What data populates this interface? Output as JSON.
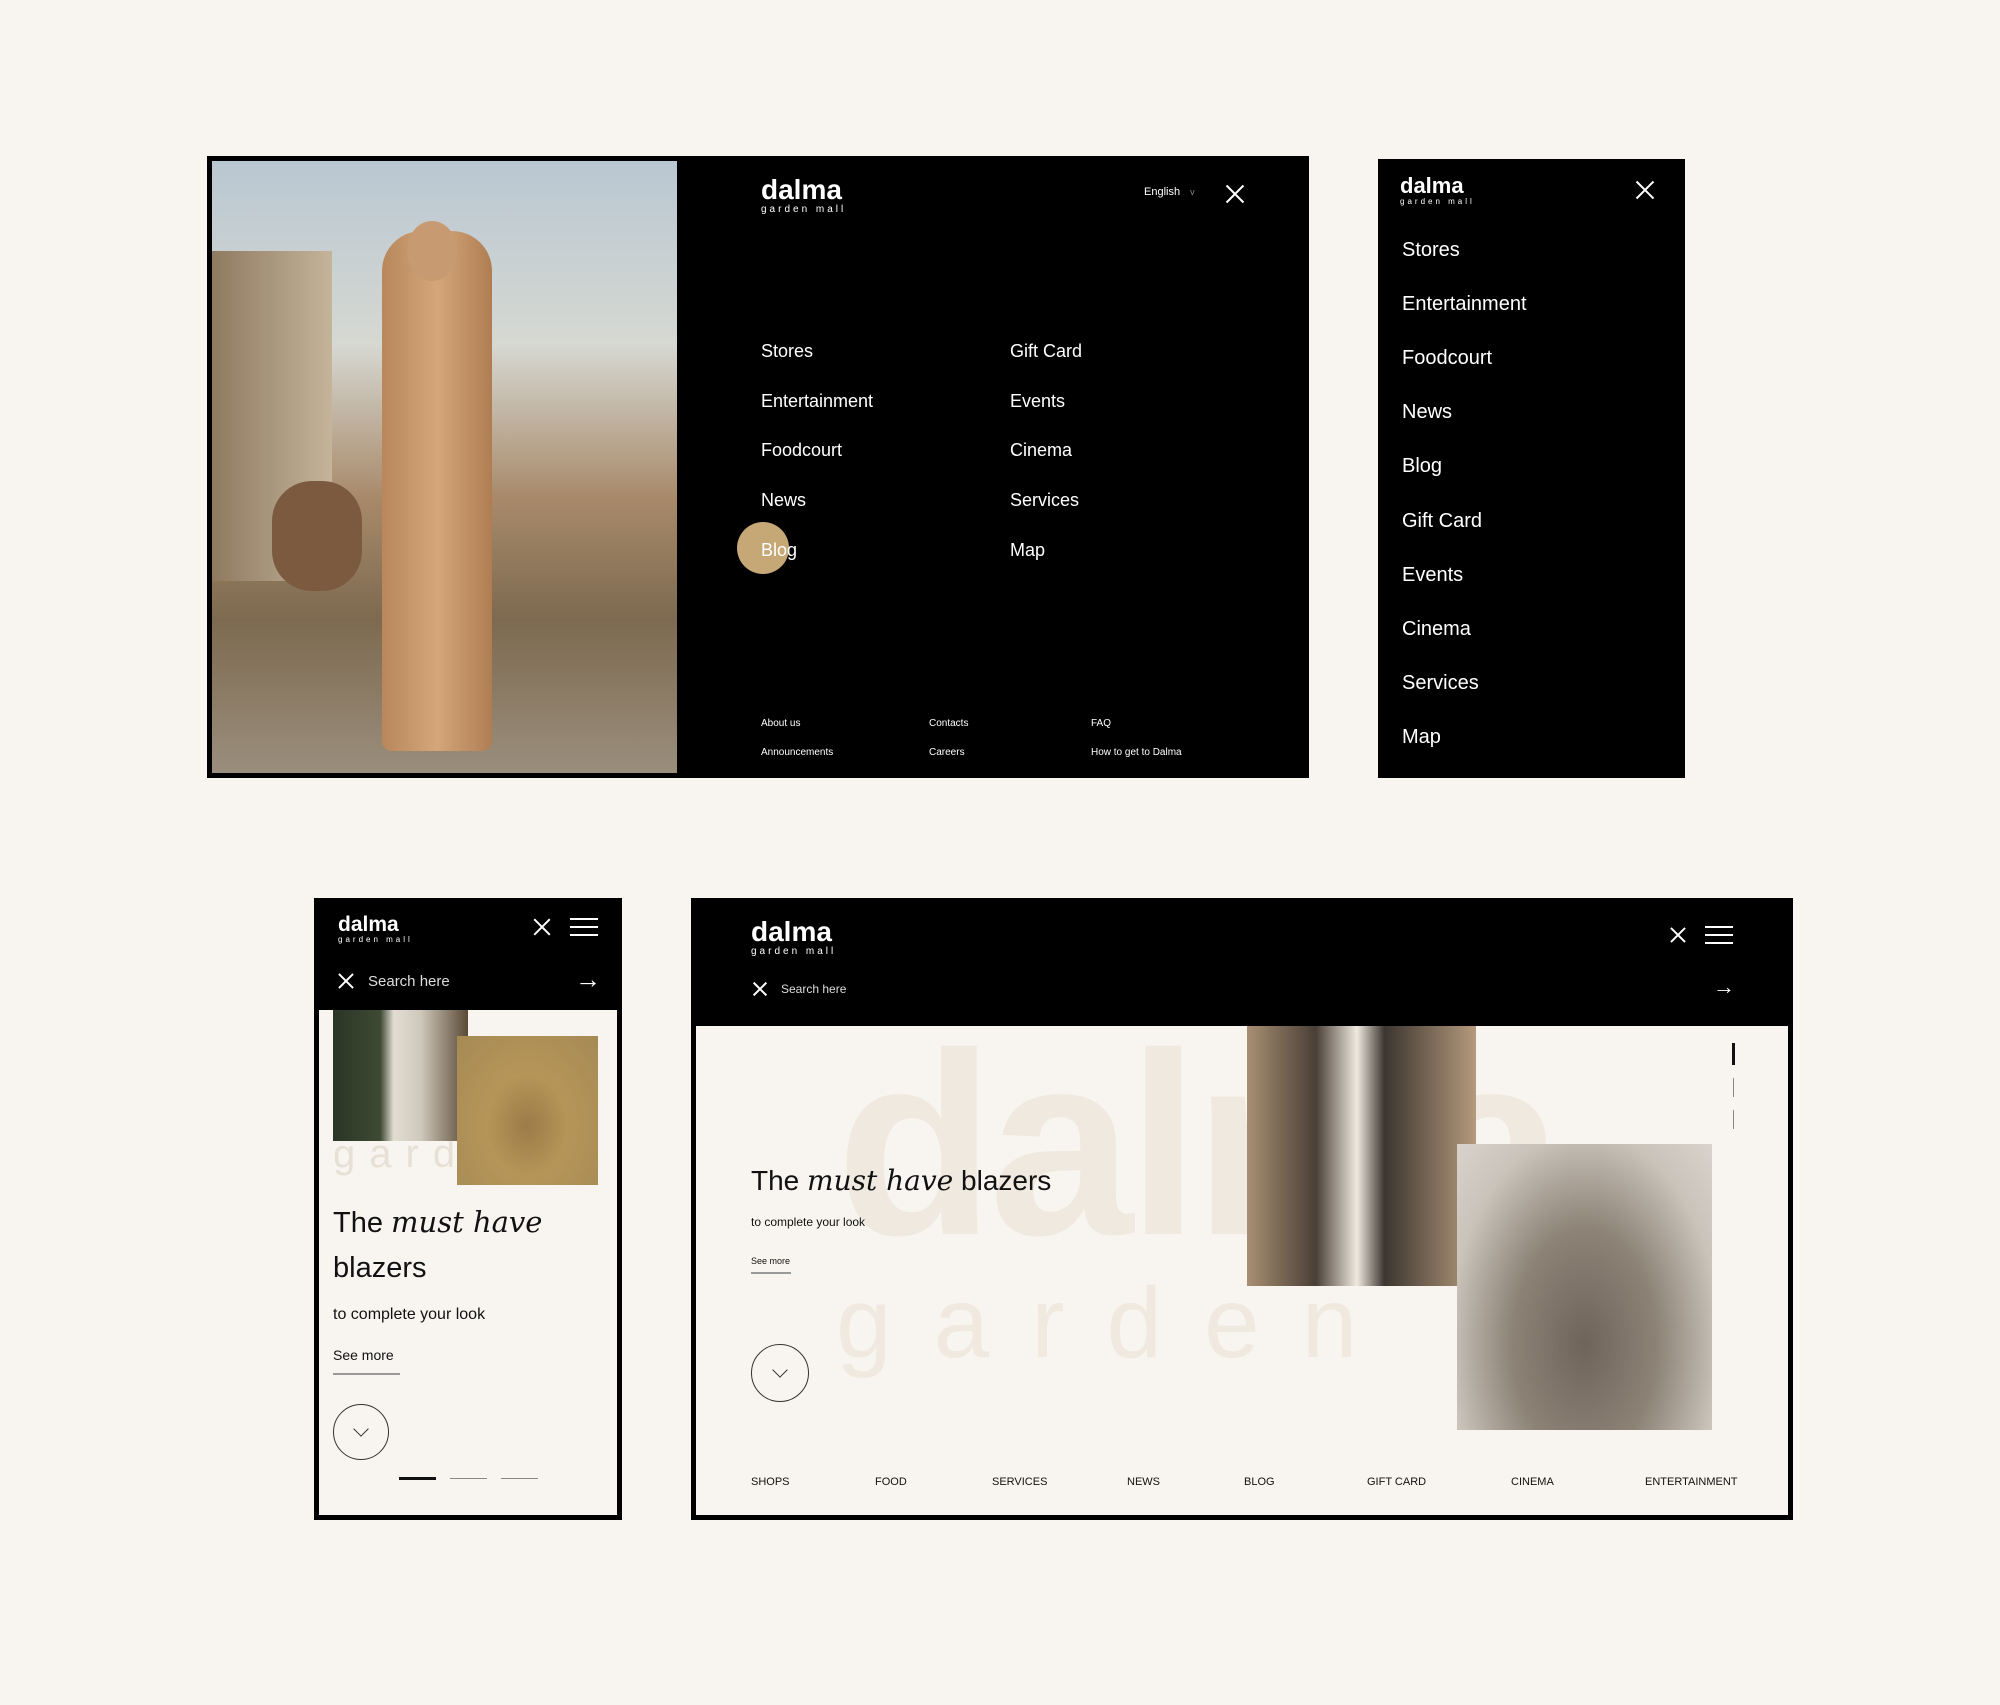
{
  "brand": {
    "name": "dalma",
    "tagline": "garden mall"
  },
  "colors": {
    "background": "#f8f5f0",
    "dark": "#000000",
    "accent": "#c5a876"
  },
  "desktop_menu": {
    "language": "English",
    "menu_col1": [
      "Stores",
      "Entertainment",
      "Foodcourt",
      "News",
      "Blog"
    ],
    "menu_col2": [
      "Gift Card",
      "Events",
      "Cinema",
      "Services",
      "Map"
    ],
    "hovered_item": "Blog",
    "footer": [
      "About us",
      "Contacts",
      "FAQ",
      "Announcements",
      "Careers",
      "How to get to Dalma"
    ]
  },
  "mobile_menu": {
    "items": [
      "Stores",
      "Entertainment",
      "Foodcourt",
      "News",
      "Blog",
      "Gift Card",
      "Events",
      "Cinema",
      "Services",
      "Map"
    ]
  },
  "mobile_home": {
    "search_placeholder": "Search here",
    "title_pre": "The ",
    "title_em": "must have",
    "title_post": "blazers",
    "subtitle": "to complete your look",
    "see_more": "See more",
    "watermark": "garden",
    "slides_total": 3,
    "slide_active": 1
  },
  "desktop_home": {
    "search_placeholder": "Search here",
    "title_pre": "The ",
    "title_em": "must have",
    "title_post": " blazers",
    "subtitle": "to complete your look",
    "see_more": "See more",
    "watermark_top": "dalma",
    "watermark_bottom": "garden m",
    "nav": [
      "SHOPS",
      "FOOD",
      "SERVICES",
      "NEWS",
      "BLOG",
      "GIFT CARD",
      "CINEMA",
      "ENTERTAINMENT"
    ]
  }
}
